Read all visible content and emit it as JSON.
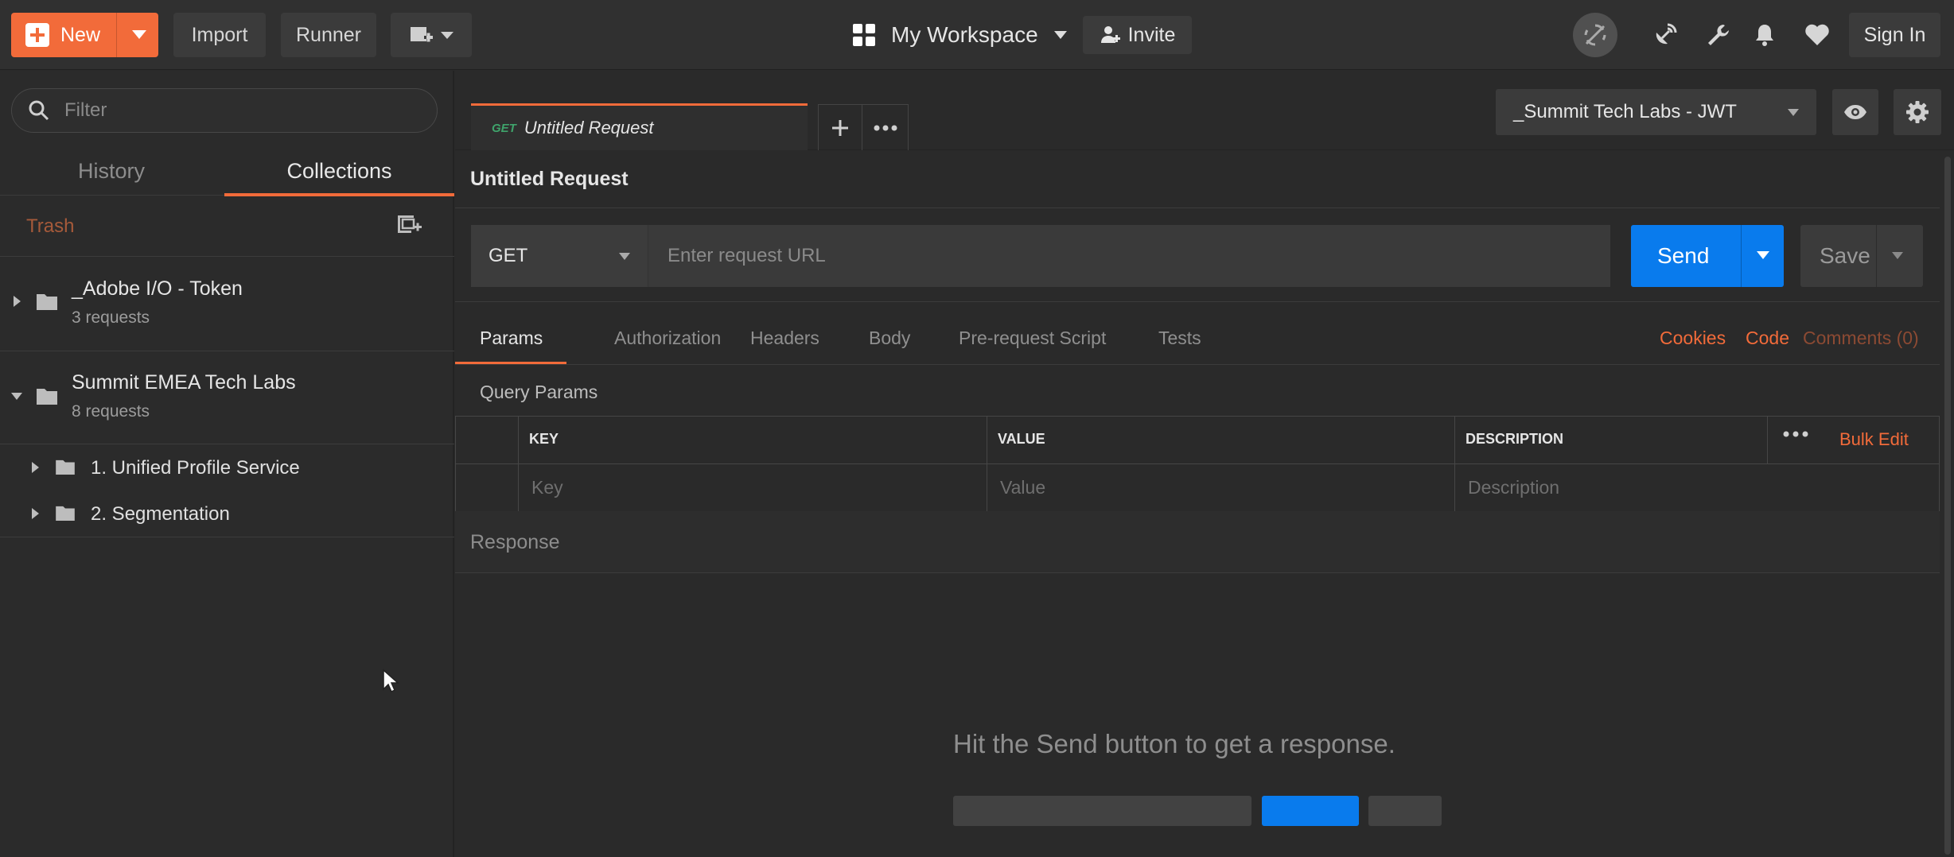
{
  "topbar": {
    "new_label": "New",
    "import_label": "Import",
    "runner_label": "Runner",
    "workspace_label": "My Workspace",
    "invite_label": "Invite",
    "signin_label": "Sign In"
  },
  "sidebar": {
    "filter_placeholder": "Filter",
    "tabs": {
      "history": "History",
      "collections": "Collections"
    },
    "trash_label": "Trash",
    "collections": [
      {
        "name": "_Adobe I/O - Token",
        "count": "3 requests"
      },
      {
        "name": "Summit EMEA Tech Labs",
        "count": "8 requests",
        "folders": [
          "1. Unified Profile Service",
          "2. Segmentation"
        ]
      }
    ]
  },
  "main": {
    "tab": {
      "method": "GET",
      "title": "Untitled Request"
    },
    "environment": "_Summit Tech Labs - JWT",
    "request_title": "Untitled Request",
    "method": "GET",
    "url_placeholder": "Enter request URL",
    "send_label": "Send",
    "save_label": "Save",
    "request_tabs": [
      "Params",
      "Authorization",
      "Headers",
      "Body",
      "Pre-request Script",
      "Tests"
    ],
    "links": {
      "cookies": "Cookies",
      "code": "Code",
      "comments": "Comments (0)"
    },
    "query_params_title": "Query Params",
    "table": {
      "headers": {
        "key": "KEY",
        "value": "VALUE",
        "description": "DESCRIPTION"
      },
      "placeholders": {
        "key": "Key",
        "value": "Value",
        "description": "Description"
      },
      "bulk_edit": "Bulk Edit"
    },
    "response_label": "Response",
    "response_hint": "Hit the Send button to get a response."
  },
  "colors": {
    "accent": "#f26b3a",
    "primary": "#097bed",
    "background": "#2a2a2a"
  }
}
